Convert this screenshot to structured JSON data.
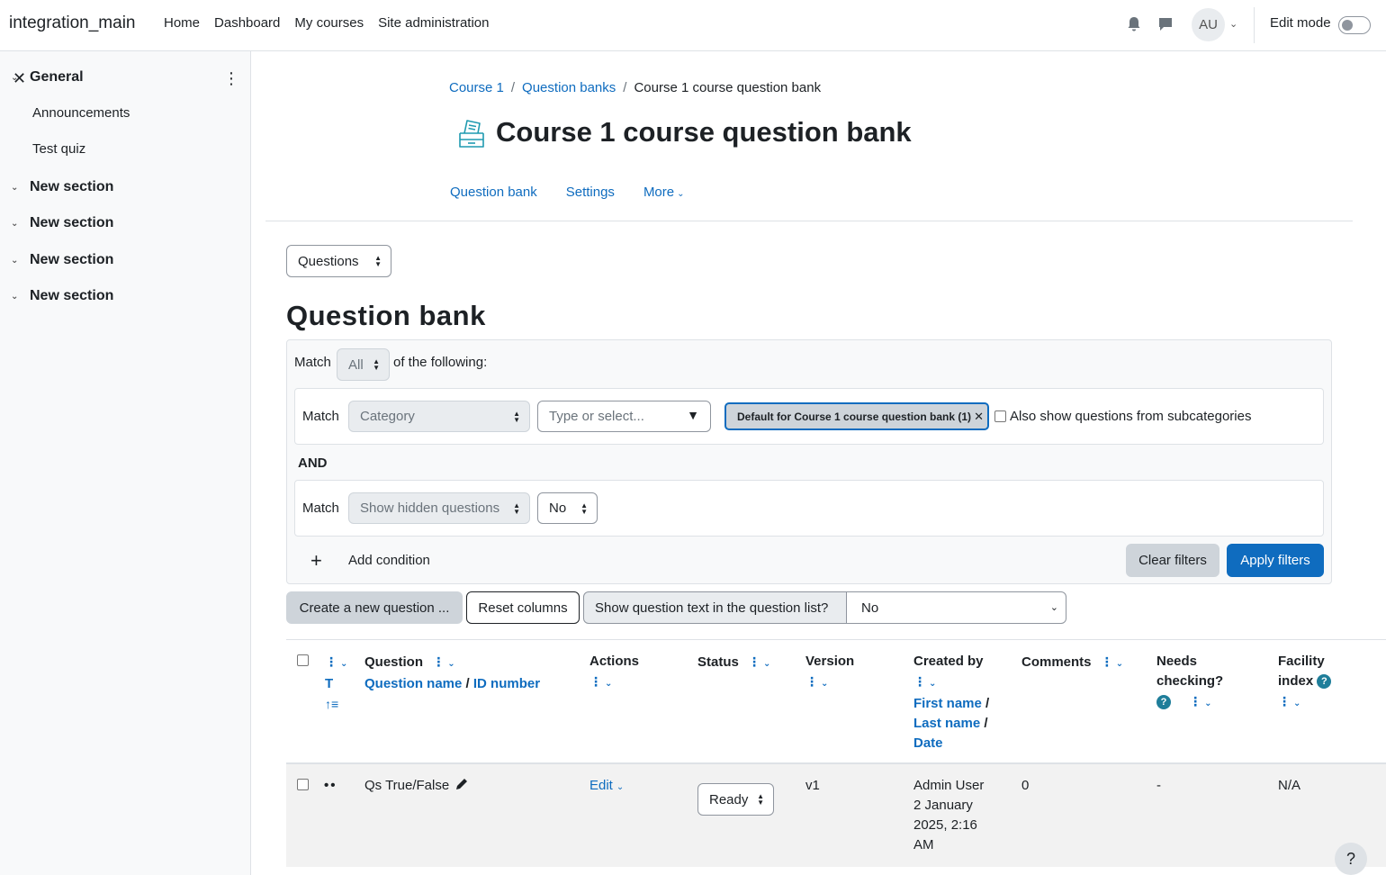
{
  "navbar": {
    "brand": "integration_main",
    "links": [
      "Home",
      "Dashboard",
      "My courses",
      "Site administration"
    ],
    "avatar_initials": "AU",
    "edit_mode_label": "Edit mode"
  },
  "drawer": {
    "sections": [
      {
        "title": "General",
        "items": [
          "Announcements",
          "Test quiz"
        ]
      },
      {
        "title": "New section",
        "items": []
      },
      {
        "title": "New section",
        "items": []
      },
      {
        "title": "New section",
        "items": []
      },
      {
        "title": "New section",
        "items": []
      }
    ]
  },
  "breadcrumb": {
    "items": [
      "Course 1",
      "Question banks",
      "Course 1 course question bank"
    ],
    "separator": "/"
  },
  "page": {
    "title": "Course 1 course question bank",
    "secondary_nav": [
      "Question bank",
      "Settings",
      "More"
    ],
    "view_select": "Questions",
    "section_title": "Question bank"
  },
  "filters": {
    "match_label": "Match",
    "match_all_value": "All",
    "of_following": "of the following:",
    "condition1": {
      "match_label": "Match",
      "type": "Category",
      "search_placeholder": "Type or select...",
      "selected_pill": "Default for Course 1 course question bank (1)",
      "subcategories_label": "Also show questions from subcategories"
    },
    "join_label": "AND",
    "condition2": {
      "match_label": "Match",
      "type": "Show hidden questions",
      "value": "No"
    },
    "add_condition": "Add condition",
    "clear_filters": "Clear filters",
    "apply_filters": "Apply filters"
  },
  "toolbar": {
    "create_new": "Create a new question ...",
    "reset_columns": "Reset columns",
    "show_text_label": "Show question text in the question list?",
    "show_text_value": "No"
  },
  "table": {
    "headers": {
      "type": "T",
      "question": "Question",
      "question_name": "Question name",
      "id_number": "ID number",
      "actions": "Actions",
      "status": "Status",
      "version": "Version",
      "created_by": "Created by",
      "first_name": "First name",
      "last_name": "Last name",
      "date": "Date",
      "comments": "Comments",
      "needs_checking_1": "Needs",
      "needs_checking_2": "checking?",
      "facility_1": "Facility",
      "facility_2": "index"
    },
    "rows": [
      {
        "question": "Qs True/False",
        "action": "Edit",
        "status": "Ready",
        "version": "v1",
        "created_by_name": "Admin User",
        "created_by_date_1": "2 January",
        "created_by_date_2": "2025, 2:16",
        "created_by_date_3": "AM",
        "comments": "0",
        "needs_checking": "-",
        "facility_index": "N/A"
      }
    ]
  },
  "help_button": "?"
}
